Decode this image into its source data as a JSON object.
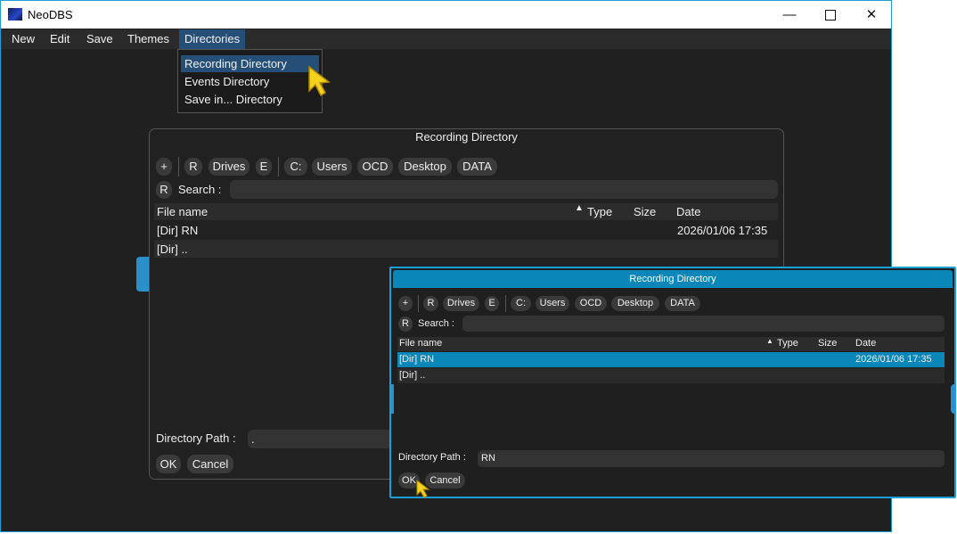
{
  "window": {
    "title": "NeoDBS",
    "minimize_icon": "minimize-icon",
    "maximize_icon": "maximize-icon",
    "close_icon": "close-icon"
  },
  "menubar": {
    "items": [
      "New",
      "Edit",
      "Save",
      "Themes",
      "Directories"
    ],
    "active": "Directories"
  },
  "directories_menu": {
    "items": [
      "Recording Directory",
      "Events Directory",
      "Save in... Directory"
    ],
    "highlighted": "Recording Directory"
  },
  "file_dialog": {
    "title": "Recording Directory",
    "toolbar": {
      "add": "+",
      "r": "R",
      "drives": "Drives",
      "e": "E",
      "path_segments": [
        "C:",
        "Users",
        "OCD",
        "Desktop",
        "DATA"
      ]
    },
    "search": {
      "r_button": "R",
      "label": "Search :",
      "value": ""
    },
    "columns": {
      "name": "File name",
      "type": "Type",
      "size": "Size",
      "date": "Date",
      "sort_icon": "sort-ascending-icon"
    },
    "rows": [
      {
        "name": "[Dir] RN",
        "type": "",
        "size": "",
        "date": "2026/01/06 17:35"
      },
      {
        "name": "[Dir] ..",
        "type": "",
        "size": "",
        "date": ""
      }
    ],
    "directory_path": {
      "label": "Directory Path :",
      "value": "."
    },
    "buttons": {
      "ok": "OK",
      "cancel": "Cancel"
    }
  },
  "zoom_dialog": {
    "title": "Recording Directory",
    "toolbar": {
      "add": "+",
      "r": "R",
      "drives": "Drives",
      "e": "E",
      "path_segments": [
        "C:",
        "Users",
        "OCD",
        "Desktop",
        "DATA"
      ]
    },
    "search": {
      "r_button": "R",
      "label": "Search :",
      "value": ""
    },
    "columns": {
      "name": "File name",
      "type": "Type",
      "size": "Size",
      "date": "Date",
      "sort_icon": "sort-ascending-icon"
    },
    "rows": [
      {
        "name": "[Dir] RN",
        "type": "",
        "size": "",
        "date": "2026/01/06 17:35",
        "selected": true
      },
      {
        "name": "[Dir] ..",
        "type": "",
        "size": "",
        "date": "",
        "selected": false
      }
    ],
    "directory_path": {
      "label": "Directory Path :",
      "value": "RN"
    },
    "buttons": {
      "ok": "OK",
      "cancel": "Cancel"
    }
  },
  "colors": {
    "accent": "#1a9fd6",
    "title_bar": "#0a86b8",
    "selection": "#0a86b8",
    "menu_highlight": "#264f78",
    "background": "#202020",
    "cursor": "#f5d21e"
  }
}
